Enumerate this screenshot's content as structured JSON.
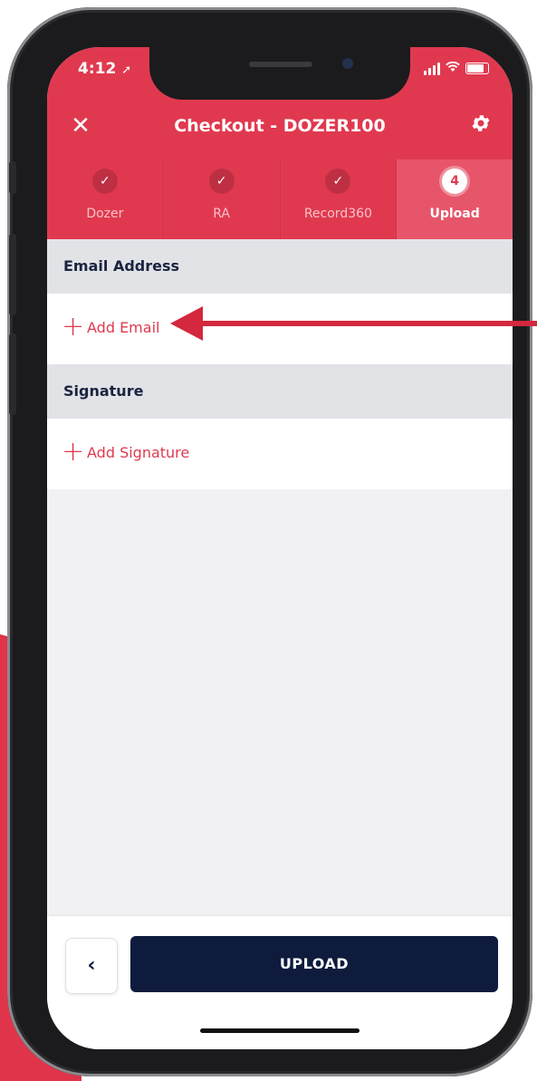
{
  "status_bar": {
    "time": "4:12"
  },
  "header": {
    "close_icon": "close-icon",
    "title": "Checkout - DOZER100",
    "settings_icon": "gear-icon"
  },
  "steps": [
    {
      "label": "Dozer",
      "state": "done",
      "icon": "check-icon"
    },
    {
      "label": "RA",
      "state": "done",
      "icon": "check-icon"
    },
    {
      "label": "Record360",
      "state": "done",
      "icon": "check-icon"
    },
    {
      "label": "Upload",
      "state": "active",
      "number": "4"
    }
  ],
  "sections": {
    "email": {
      "heading": "Email Address",
      "add_label": "Add Email"
    },
    "signature": {
      "heading": "Signature",
      "add_label": "Add Signature"
    }
  },
  "footer": {
    "back_icon": "chevron-left-icon",
    "upload_label": "UPLOAD"
  },
  "colors": {
    "accent": "#e0394f",
    "navy": "#0e1b3d",
    "arrow": "#d3283e"
  }
}
